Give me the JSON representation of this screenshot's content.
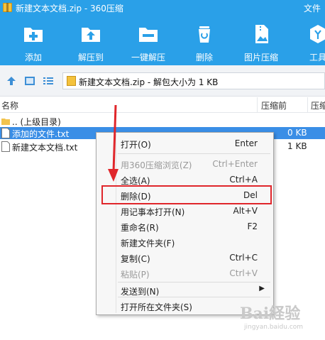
{
  "window": {
    "title": "新建文本文档.zip - 360压缩",
    "menu_file": "文件"
  },
  "toolbar": {
    "items": [
      {
        "label": "添加",
        "icon": "add-icon"
      },
      {
        "label": "解压到",
        "icon": "extract-to-icon"
      },
      {
        "label": "一键解压",
        "icon": "one-click-extract-icon"
      },
      {
        "label": "删除",
        "icon": "trash-icon"
      },
      {
        "label": "图片压缩",
        "icon": "image-compress-icon"
      },
      {
        "label": "工具",
        "icon": "tools-icon"
      }
    ],
    "color": "#2aa0e8"
  },
  "addressbar": {
    "path": "新建文本文档.zip - 解包大小为 1 KB"
  },
  "columns": {
    "name": "名称",
    "before": "压缩前",
    "after": "压缩"
  },
  "files": [
    {
      "name": ".. (上级目录)",
      "size": "",
      "type": "folder"
    },
    {
      "name": "添加的文件.txt",
      "size": "0 KB",
      "type": "text",
      "selected": true
    },
    {
      "name": "新建文本文档.txt",
      "size": "1 KB",
      "type": "text"
    }
  ],
  "context_menu": {
    "items": [
      {
        "label": "打开(O)",
        "shortcut": "Enter",
        "enabled": true
      },
      {
        "label": "用360压缩浏览(Z)",
        "shortcut": "Ctrl+Enter",
        "enabled": false
      },
      {
        "label": "全选(A)",
        "shortcut": "Ctrl+A",
        "enabled": true
      },
      {
        "label": "删除(D)",
        "shortcut": "Del",
        "enabled": true,
        "highlighted": true
      },
      {
        "label": "用记事本打开(N)",
        "shortcut": "Alt+V",
        "enabled": true
      },
      {
        "label": "重命名(R)",
        "shortcut": "F2",
        "enabled": true
      },
      {
        "label": "新建文件夹(F)",
        "shortcut": "",
        "enabled": true
      },
      {
        "label": "复制(C)",
        "shortcut": "Ctrl+C",
        "enabled": true
      },
      {
        "label": "粘贴(P)",
        "shortcut": "Ctrl+V",
        "enabled": false
      },
      {
        "label": "发送到(N)",
        "shortcut": "",
        "enabled": true,
        "submenu": true
      },
      {
        "label": "打开所在文件夹(S)",
        "shortcut": "",
        "enabled": true
      }
    ]
  },
  "annotation": {
    "highlight_color": "#e0262b"
  },
  "watermark": {
    "logo": "Bai経验",
    "sub": "jingyan.baidu.com"
  }
}
